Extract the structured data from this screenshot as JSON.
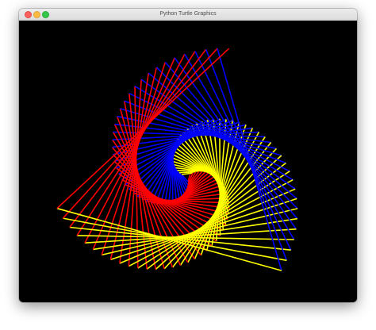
{
  "window": {
    "title": "Python Turtle Graphics"
  },
  "canvas": {
    "background_color": "#000000",
    "drawing": "triangular spiral of lines",
    "colors": [
      "#ff0000",
      "#0000ff",
      "#ffff00"
    ]
  },
  "colors": {
    "close": "#fc615d",
    "minimize": "#fdbc40",
    "zoom": "#34c84a"
  }
}
